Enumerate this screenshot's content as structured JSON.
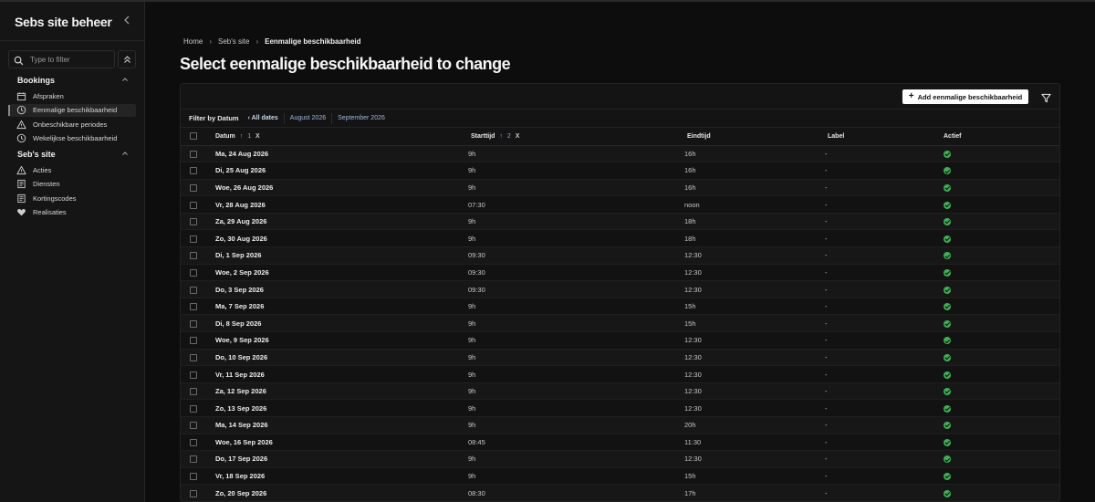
{
  "sidebar": {
    "brand": "Sebs site beheer",
    "filter_placeholder": "Type to filter",
    "groups": [
      {
        "title": "Bookings",
        "items": [
          {
            "label": "Afspraken",
            "icon": "calendar-icon"
          },
          {
            "label": "Eenmalige beschikbaarheid",
            "icon": "clock-icon",
            "active": true
          },
          {
            "label": "Onbeschikbare periodes",
            "icon": "warning-icon"
          },
          {
            "label": "Wekelijkse beschikbaarheid",
            "icon": "clock-icon"
          }
        ]
      },
      {
        "title": "Seb's site",
        "items": [
          {
            "label": "Acties",
            "icon": "warning-icon"
          },
          {
            "label": "Diensten",
            "icon": "document-icon"
          },
          {
            "label": "Kortingscodes",
            "icon": "document-icon"
          },
          {
            "label": "Realisaties",
            "icon": "heart-icon"
          }
        ]
      }
    ]
  },
  "breadcrumb": [
    "Home",
    "Seb's site",
    "Eenmalige beschikbaarheid"
  ],
  "page_title": "Select eenmalige beschikbaarheid to change",
  "toolbar": {
    "add_label": "Add eenmalige beschikbaarheid"
  },
  "filter": {
    "label": "Filter by Datum",
    "options": [
      "‹ All dates",
      "August 2026",
      "September 2026"
    ]
  },
  "table": {
    "columns": [
      {
        "label": "Datum",
        "sort": "1",
        "remove": "X"
      },
      {
        "label": "Starttijd",
        "sort": "2",
        "remove": "X"
      },
      {
        "label": "Eindtijd"
      },
      {
        "label": "Label"
      },
      {
        "label": "Actief"
      }
    ],
    "rows": [
      {
        "datum": "Ma, 24 Aug 2026",
        "start": "9h",
        "end": "16h",
        "label": "-",
        "actief": true
      },
      {
        "datum": "Di, 25 Aug 2026",
        "start": "9h",
        "end": "16h",
        "label": "-",
        "actief": true
      },
      {
        "datum": "Woe, 26 Aug 2026",
        "start": "9h",
        "end": "16h",
        "label": "-",
        "actief": true
      },
      {
        "datum": "Vr, 28 Aug 2026",
        "start": "07:30",
        "end": "noon",
        "label": "-",
        "actief": true
      },
      {
        "datum": "Za, 29 Aug 2026",
        "start": "9h",
        "end": "18h",
        "label": "-",
        "actief": true
      },
      {
        "datum": "Zo, 30 Aug 2026",
        "start": "9h",
        "end": "18h",
        "label": "-",
        "actief": true
      },
      {
        "datum": "Di, 1 Sep 2026",
        "start": "09:30",
        "end": "12:30",
        "label": "-",
        "actief": true
      },
      {
        "datum": "Woe, 2 Sep 2026",
        "start": "09:30",
        "end": "12:30",
        "label": "-",
        "actief": true
      },
      {
        "datum": "Do, 3 Sep 2026",
        "start": "09:30",
        "end": "12:30",
        "label": "-",
        "actief": true
      },
      {
        "datum": "Ma, 7 Sep 2026",
        "start": "9h",
        "end": "15h",
        "label": "-",
        "actief": true
      },
      {
        "datum": "Di, 8 Sep 2026",
        "start": "9h",
        "end": "15h",
        "label": "-",
        "actief": true
      },
      {
        "datum": "Woe, 9 Sep 2026",
        "start": "9h",
        "end": "12:30",
        "label": "-",
        "actief": true
      },
      {
        "datum": "Do, 10 Sep 2026",
        "start": "9h",
        "end": "12:30",
        "label": "-",
        "actief": true
      },
      {
        "datum": "Vr, 11 Sep 2026",
        "start": "9h",
        "end": "12:30",
        "label": "-",
        "actief": true
      },
      {
        "datum": "Za, 12 Sep 2026",
        "start": "9h",
        "end": "12:30",
        "label": "-",
        "actief": true
      },
      {
        "datum": "Zo, 13 Sep 2026",
        "start": "9h",
        "end": "12:30",
        "label": "-",
        "actief": true
      },
      {
        "datum": "Ma, 14 Sep 2026",
        "start": "9h",
        "end": "20h",
        "label": "-",
        "actief": true
      },
      {
        "datum": "Woe, 16 Sep 2026",
        "start": "08:45",
        "end": "11:30",
        "label": "-",
        "actief": true
      },
      {
        "datum": "Do, 17 Sep 2026",
        "start": "9h",
        "end": "12:30",
        "label": "-",
        "actief": true
      },
      {
        "datum": "Vr, 18 Sep 2026",
        "start": "9h",
        "end": "15h",
        "label": "-",
        "actief": true
      },
      {
        "datum": "Zo, 20 Sep 2026",
        "start": "08:30",
        "end": "17h",
        "label": "-",
        "actief": true
      }
    ]
  }
}
